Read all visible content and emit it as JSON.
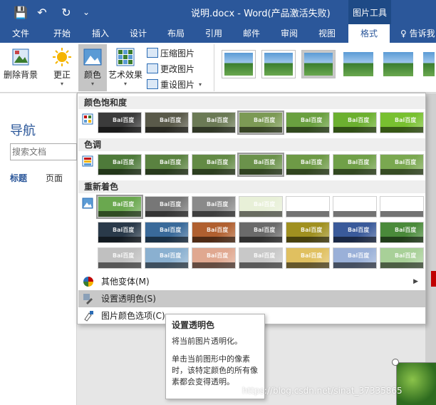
{
  "title_bar": {
    "document_title": "说明.docx - Word(产品激活失败)",
    "context_group": "图片工具",
    "quick_access": [
      {
        "icon": "save-icon",
        "glyph": "💾"
      },
      {
        "icon": "undo-icon",
        "glyph": "↶"
      },
      {
        "icon": "redo-icon",
        "glyph": "↻"
      },
      {
        "icon": "customize-icon",
        "glyph": "⌄"
      }
    ]
  },
  "tabs": [
    {
      "label": "文件"
    },
    {
      "label": "开始"
    },
    {
      "label": "插入"
    },
    {
      "label": "设计"
    },
    {
      "label": "布局"
    },
    {
      "label": "引用"
    },
    {
      "label": "邮件"
    },
    {
      "label": "审阅"
    },
    {
      "label": "视图"
    },
    {
      "label": "格式",
      "active": true
    }
  ],
  "tell_me": "♀ 告诉我",
  "ribbon": {
    "remove_bg": "删除背景",
    "corrections": "更正",
    "color": "颜色",
    "artistic": "艺术效果",
    "compress": "压缩图片",
    "change": "更改图片",
    "reset": "重设图片"
  },
  "nav": {
    "title": "导航",
    "search_placeholder": "搜索文档",
    "tab_headings": "标题",
    "tab_pages": "页面"
  },
  "color_menu": {
    "saturation_header": "颜色饱和度",
    "tone_header": "色调",
    "recolor_header": "重新着色",
    "more_variations": "其他变体(M)",
    "set_transparent": "设置透明色(S)",
    "picture_color_options": "图片颜色选项(C)...",
    "watermark_text": "Bai百度",
    "saturation_swatches": [
      "#3b3b3b",
      "#5a5a4a",
      "#6b7a55",
      "#7c9a55",
      "#6aa040",
      "#6cb030",
      "#78c030"
    ],
    "saturation_selected": 3,
    "tone_swatches": [
      "#4e7a3a",
      "#5a8240",
      "#638a45",
      "#6b924b",
      "#6e9a46",
      "#70a048",
      "#7aa850"
    ],
    "tone_selected": 3,
    "recolor_rows": [
      [
        "#6aa84f",
        "#777777",
        "#8a8a8a",
        "#e8f0d8",
        "#ffffff",
        "#ffffff",
        "#ffffff"
      ],
      [
        "#2a3a4a",
        "#3a6a9a",
        "#b06030",
        "#6a6a6a",
        "#a09020",
        "#3a5a9a",
        "#4a8a3a"
      ],
      [
        "#c0c0c0",
        "#8ab0d0",
        "#e0a890",
        "#c8c8c8",
        "#e0c060",
        "#9ab0d8",
        "#a8d098"
      ]
    ],
    "recolor_selected": 0
  },
  "tooltip": {
    "title": "设置透明色",
    "body1": "将当前图片透明化。",
    "body2": "单击当前图形中的像素时，该特定颜色的所有像素都会变得透明。"
  },
  "watermark": "https://blog.csdn.net/sinat_37335865"
}
